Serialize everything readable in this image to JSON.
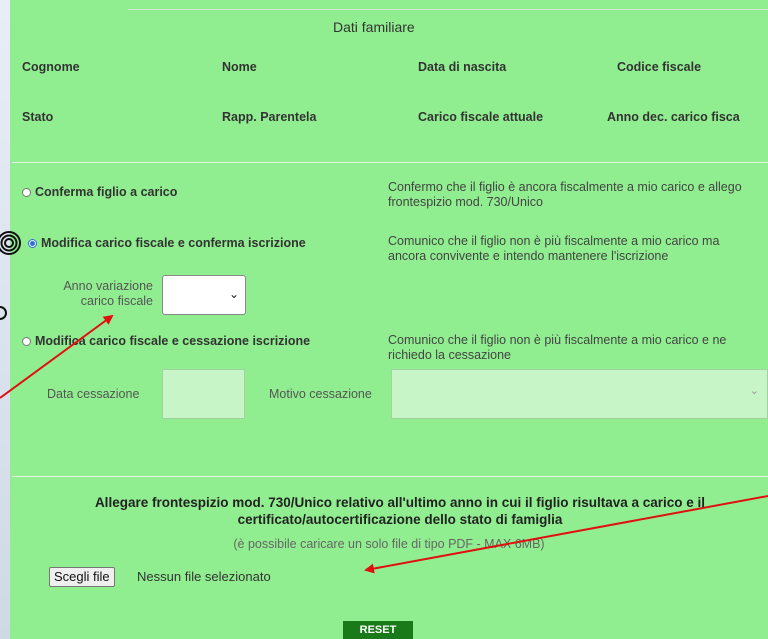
{
  "section_title": "Dati familiare",
  "headers_row1": [
    "Cognome",
    "Nome",
    "Data di nascita",
    "Codice fiscale"
  ],
  "headers_row2": [
    "Stato",
    "Rapp. Parentela",
    "Carico fiscale attuale",
    "Anno dec. carico fisca"
  ],
  "options": [
    {
      "label": "Conferma figlio a carico",
      "checked": false,
      "description": "Confermo che il figlio è ancora fiscalmente a mio carico e allego frontespizio mod. 730/Unico"
    },
    {
      "label": "Modifica carico fiscale e conferma iscrizione",
      "checked": true,
      "description": "Comunico che il figlio non è più fiscalmente a mio carico ma ancora convivente e intendo mantenere l'iscrizione"
    },
    {
      "label": "Modifica carico fiscale e cessazione iscrizione",
      "checked": false,
      "description": "Comunico che il figlio non è più fiscalmente a mio carico e ne richiedo la cessazione"
    }
  ],
  "anno_variazione": {
    "label_line1": "Anno variazione",
    "label_line2": "carico fiscale",
    "value": ""
  },
  "data_cessazione_label": "Data cessazione",
  "motivo_cessazione_label": "Motivo cessazione",
  "attachment": {
    "title": "Allegare frontespizio mod. 730/Unico relativo all'ultimo anno in cui il figlio risultava a carico e il certificato/autocertificazione dello stato di famiglia",
    "note": "(è possibile caricare un solo file di tipo PDF - MAX 6MB)",
    "file_button_label": "Scegli file",
    "file_status": "Nessun file selezionato"
  },
  "reset_label": "RESET",
  "colors": {
    "panel": "#90ee90",
    "reset": "#1a7a1a",
    "arrow": "#e01010",
    "radio_checked": "#2a6fd6"
  }
}
